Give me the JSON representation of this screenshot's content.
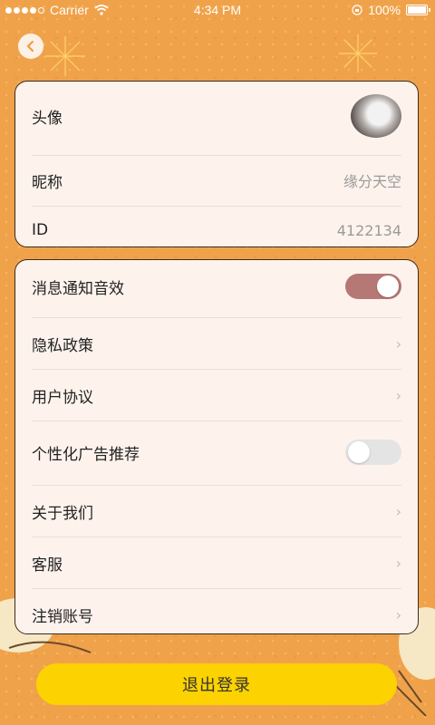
{
  "status_bar": {
    "carrier": "Carrier",
    "time": "4:34 PM",
    "battery": "100%"
  },
  "profile": {
    "avatar_label": "头像",
    "nickname_label": "昵称",
    "nickname_value": "缘分天空",
    "id_label": "ID",
    "id_value": "4122134"
  },
  "settings": {
    "notify_sound_label": "消息通知音效",
    "notify_sound_on": true,
    "privacy_label": "隐私政策",
    "agreement_label": "用户协议",
    "personalized_ads_label": "个性化广告推荐",
    "personalized_ads_on": false,
    "about_label": "关于我们",
    "service_label": "客服",
    "cancel_account_label": "注销账号",
    "chevron": "›"
  },
  "logout_label": "退出登录",
  "colors": {
    "background": "#f0a24a",
    "card": "#fdf3ec",
    "toggle_on": "#b57875",
    "logout": "#fcd200"
  }
}
